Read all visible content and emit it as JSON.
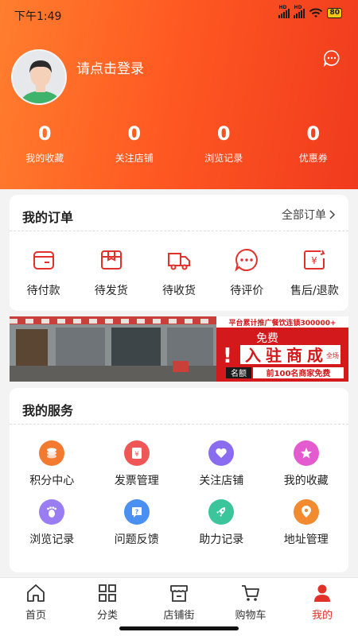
{
  "status_bar": {
    "time": "下午1:49",
    "battery": "80"
  },
  "profile": {
    "login_text": "请点击登录"
  },
  "stats": [
    {
      "value": "0",
      "label": "我的收藏"
    },
    {
      "value": "0",
      "label": "关注店铺"
    },
    {
      "value": "0",
      "label": "浏览记录"
    },
    {
      "value": "0",
      "label": "优惠券"
    }
  ],
  "orders": {
    "title": "我的订单",
    "more": "全部订单",
    "items": [
      {
        "label": "待付款",
        "icon": "wallet-icon"
      },
      {
        "label": "待发货",
        "icon": "box-icon"
      },
      {
        "label": "待收货",
        "icon": "truck-icon"
      },
      {
        "label": "待评价",
        "icon": "comment-icon"
      },
      {
        "label": "售后/退款",
        "icon": "refund-icon"
      }
    ]
  },
  "banner": {
    "top_text": "平台累计推广餐饮连锁300000+",
    "free": "免费",
    "main_a": "入",
    "main_b": "驻",
    "main_c": "商",
    "main_d": "成",
    "side": "全场",
    "quota_label": "名额",
    "quota_text": "前100名商家免费"
  },
  "services": {
    "title": "我的服务",
    "items": [
      {
        "label": "积分中心",
        "icon": "coins-icon",
        "color": "#f47a2f"
      },
      {
        "label": "发票管理",
        "icon": "invoice-icon",
        "color": "#ef5757"
      },
      {
        "label": "关注店铺",
        "icon": "heart-icon",
        "color": "#8a6cf0"
      },
      {
        "label": "我的收藏",
        "icon": "star-icon",
        "color": "#e45bd0"
      },
      {
        "label": "浏览记录",
        "icon": "footprint-icon",
        "color": "#9a7df2"
      },
      {
        "label": "问题反馈",
        "icon": "question-icon",
        "color": "#4a90f0"
      },
      {
        "label": "助力记录",
        "icon": "rocket-icon",
        "color": "#3cc49a"
      },
      {
        "label": "地址管理",
        "icon": "location-icon",
        "color": "#f28a2f"
      }
    ]
  },
  "tabbar": [
    {
      "label": "首页",
      "icon": "home-icon"
    },
    {
      "label": "分类",
      "icon": "grid-icon"
    },
    {
      "label": "店铺街",
      "icon": "store-icon"
    },
    {
      "label": "购物车",
      "icon": "cart-icon"
    },
    {
      "label": "我的",
      "icon": "user-icon",
      "active": true
    }
  ],
  "colors": {
    "accent": "#e0322a",
    "hero_start": "#ff7e2e",
    "hero_end": "#f03a1e"
  }
}
